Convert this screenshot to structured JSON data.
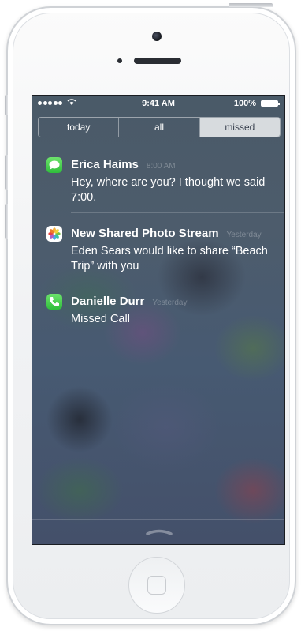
{
  "status_bar": {
    "time": "9:41 AM",
    "battery": "100%"
  },
  "tabs": [
    {
      "label": "today",
      "active": false
    },
    {
      "label": "all",
      "active": false
    },
    {
      "label": "missed",
      "active": true
    }
  ],
  "notifications": [
    {
      "app_icon": "messages-icon",
      "title": "Erica Haims",
      "time": "8:00 AM",
      "body": "Hey, where are you? I thought we said 7:00."
    },
    {
      "app_icon": "photos-icon",
      "title": "New Shared Photo Stream",
      "time": "Yesterday",
      "body": "Eden Sears would like to share “Beach Trip” with you"
    },
    {
      "app_icon": "phone-icon",
      "title": "Danielle Durr",
      "time": "Yesterday",
      "body": "Missed Call"
    }
  ],
  "colors": {
    "accent_green": "#2fbe3b",
    "segment_active": "#ffffff"
  }
}
